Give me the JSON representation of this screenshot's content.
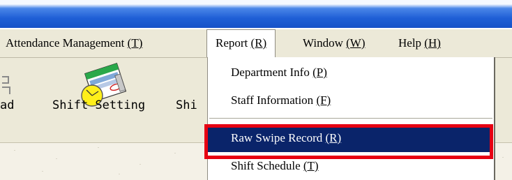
{
  "menubar": {
    "items": [
      {
        "label": "Attendance Management ",
        "key": "(T)"
      },
      {
        "label": "Report ",
        "key": "(R)"
      },
      {
        "label": "Window ",
        "key": "(W)"
      },
      {
        "label": "Help ",
        "key": "(H)"
      }
    ]
  },
  "toolbar": {
    "items": [
      {
        "label": "ad",
        "icon": "record-icon"
      },
      {
        "label": "Shift Setting",
        "icon": "shift-setting-icon"
      },
      {
        "label": "Shi",
        "icon": "shift-icon"
      }
    ]
  },
  "report_menu": {
    "items": [
      {
        "label": "Department Info ",
        "key": "(P)"
      },
      {
        "label": "Staff Information ",
        "key": "(F)"
      },
      {
        "label": "Raw Swipe Record ",
        "key": "(R)"
      },
      {
        "label": "Shift Schedule ",
        "key": "(T)"
      }
    ],
    "selected_index": 2
  },
  "colors": {
    "highlight": "#0a246a",
    "annotation": "#e60012",
    "menu_bg": "#ece9d8"
  }
}
